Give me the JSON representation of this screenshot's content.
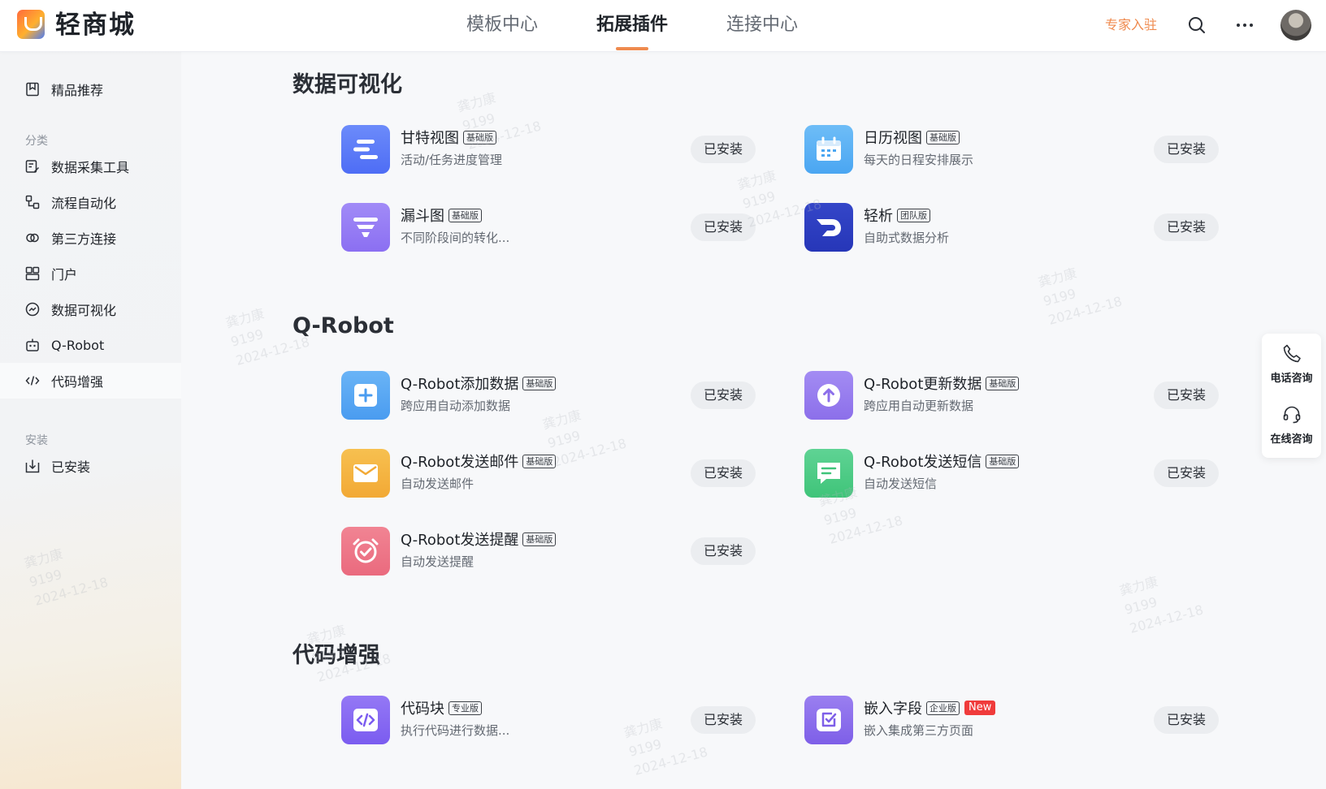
{
  "app": {
    "name": "轻商城"
  },
  "nav": {
    "tabs": [
      {
        "label": "模板中心"
      },
      {
        "label": "拓展插件",
        "active": true
      },
      {
        "label": "连接中心"
      }
    ]
  },
  "header": {
    "expert_label": "专家入驻",
    "icons": [
      "search-icon",
      "more-icon"
    ]
  },
  "sidebar": {
    "featured": {
      "label": "精品推荐",
      "icon": "bookmark-icon"
    },
    "category_label": "分类",
    "categories": [
      {
        "label": "数据采集工具",
        "icon": "form-edit-icon"
      },
      {
        "label": "流程自动化",
        "icon": "flow-icon"
      },
      {
        "label": "第三方连接",
        "icon": "link-icon"
      },
      {
        "label": "门户",
        "icon": "portal-icon"
      },
      {
        "label": "数据可视化",
        "icon": "chart-icon"
      },
      {
        "label": "Q-Robot",
        "icon": "robot-icon"
      },
      {
        "label": "代码增强",
        "icon": "code-icon"
      }
    ],
    "install_label": "安装",
    "installed": {
      "label": "已安装",
      "icon": "download-icon"
    }
  },
  "sections": [
    {
      "title": "数据可视化",
      "plugins": [
        {
          "name": "甘特视图",
          "tier": "基础版",
          "desc": "活动/任务进度管理",
          "button": "已安装",
          "icon": "gantt-icon",
          "color": "#4e6df5"
        },
        {
          "name": "日历视图",
          "tier": "基础版",
          "desc": "每天的日程安排展示",
          "button": "已安装",
          "icon": "calendar-icon",
          "color": "#4aa6f2"
        },
        {
          "name": "漏斗图",
          "tier": "基础版",
          "desc": "不同阶段间的转化...",
          "button": "已安装",
          "icon": "funnel-icon",
          "color": "#8b6ff2"
        },
        {
          "name": "轻析",
          "tier": "团队版",
          "desc": "自助式数据分析",
          "button": "已安装",
          "icon": "analytics-icon",
          "color": "#2636b8"
        }
      ]
    },
    {
      "title": "Q-Robot",
      "plugins": [
        {
          "name": "Q-Robot添加数据",
          "tier": "基础版",
          "desc": "跨应用自动添加数据",
          "button": "已安装",
          "icon": "plus-icon",
          "color": "#4a9cf0"
        },
        {
          "name": "Q-Robot更新数据",
          "tier": "基础版",
          "desc": "跨应用自动更新数据",
          "button": "已安装",
          "icon": "upload-icon",
          "color": "#8c6fea"
        },
        {
          "name": "Q-Robot发送邮件",
          "tier": "基础版",
          "desc": "自动发送邮件",
          "button": "已安装",
          "icon": "mail-icon",
          "color": "#f2a935"
        },
        {
          "name": "Q-Robot发送短信",
          "tier": "基础版",
          "desc": "自动发送短信",
          "button": "已安装",
          "icon": "message-icon",
          "color": "#3fc479"
        },
        {
          "name": "Q-Robot发送提醒",
          "tier": "基础版",
          "desc": "自动发送提醒",
          "button": "已安装",
          "icon": "alarm-icon",
          "color": "#ea6a7e"
        }
      ]
    },
    {
      "title": "代码增强",
      "plugins": [
        {
          "name": "代码块",
          "tier": "专业版",
          "desc": "执行代码进行数据...",
          "button": "已安装",
          "icon": "code-block-icon",
          "color": "#7b5cf0"
        },
        {
          "name": "嵌入字段",
          "tier": "企业版",
          "badge": "New",
          "desc": "嵌入集成第三方页面",
          "button": "已安装",
          "icon": "embed-icon",
          "color": "#7e5fe8"
        }
      ]
    }
  ],
  "float_panel": {
    "items": [
      {
        "label": "电话咨询",
        "icon": "phone-icon"
      },
      {
        "label": "在线咨询",
        "icon": "headset-icon"
      }
    ]
  },
  "watermark": {
    "name": "龚力康",
    "id": "9199",
    "date": "2024-12-18"
  },
  "colors": {
    "accent": "#ef8a4e",
    "button_bg": "#ebedf0",
    "new_badge": "#f03b3b"
  }
}
